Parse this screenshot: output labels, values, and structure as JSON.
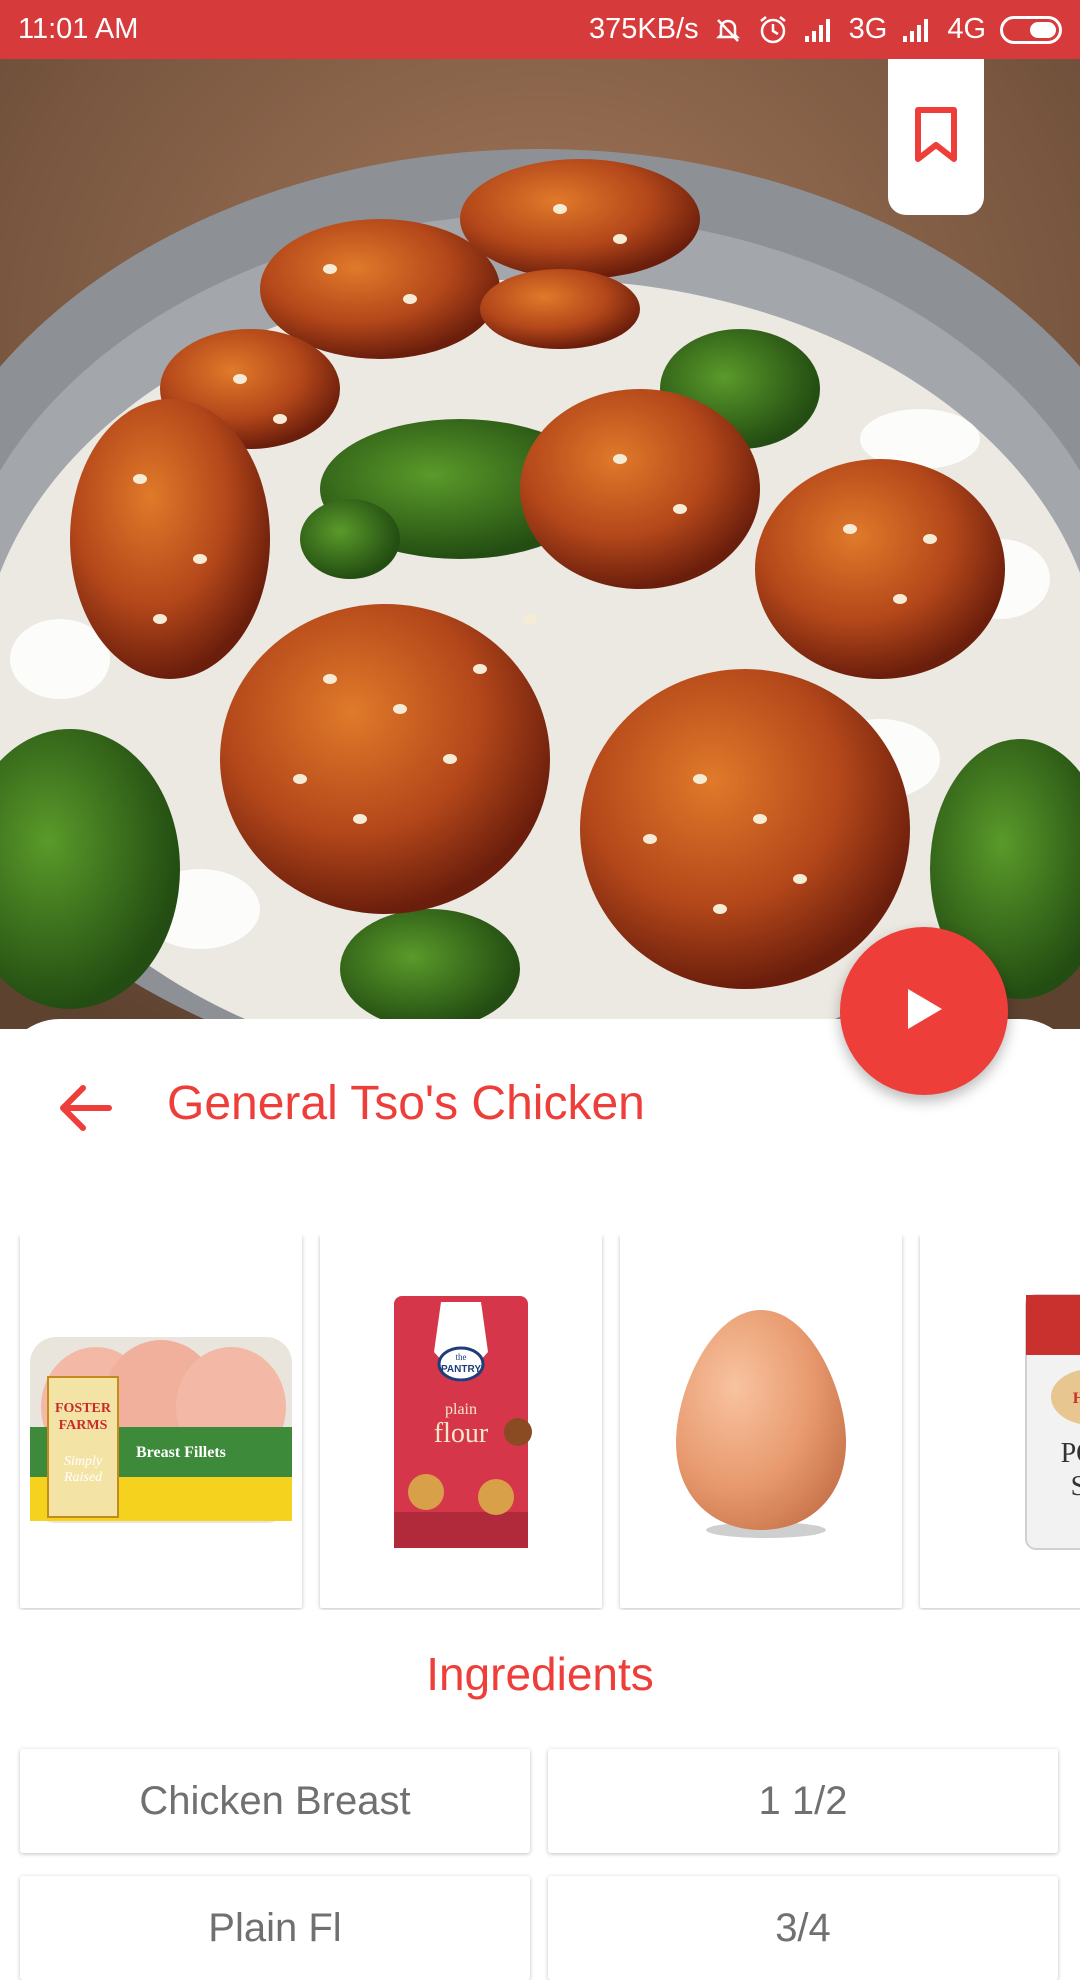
{
  "status_bar": {
    "time": "11:01 AM",
    "network_speed": "375KB/s",
    "signal_1_label": "3G",
    "signal_2_label": "4G",
    "icons": [
      "mute-icon",
      "alarm-icon",
      "signal-icon",
      "signal-icon",
      "battery-icon"
    ]
  },
  "hero": {
    "icon_bookmark": "bookmark-icon"
  },
  "recipe": {
    "title": "General Tso's Chicken",
    "back_icon": "arrow-left-icon",
    "play_icon": "play-icon"
  },
  "ingredient_cards": [
    {
      "name": "Chicken Breast",
      "image": "chicken-breast-package"
    },
    {
      "name": "Plain Flour",
      "image": "flour-bag"
    },
    {
      "name": "Egg",
      "image": "egg"
    },
    {
      "name": "Potato Starch",
      "image": "potato-starch-bag"
    }
  ],
  "ingredients_heading": "Ingredients",
  "ingredients": [
    {
      "name": "Chicken Breast",
      "quantity": "1 1/2"
    },
    {
      "name": "Plain Fl",
      "quantity": "3/4"
    }
  ],
  "colors": {
    "accent": "#ee3e3a",
    "status_bar": "#d73a3a",
    "text_gray": "#707070"
  }
}
